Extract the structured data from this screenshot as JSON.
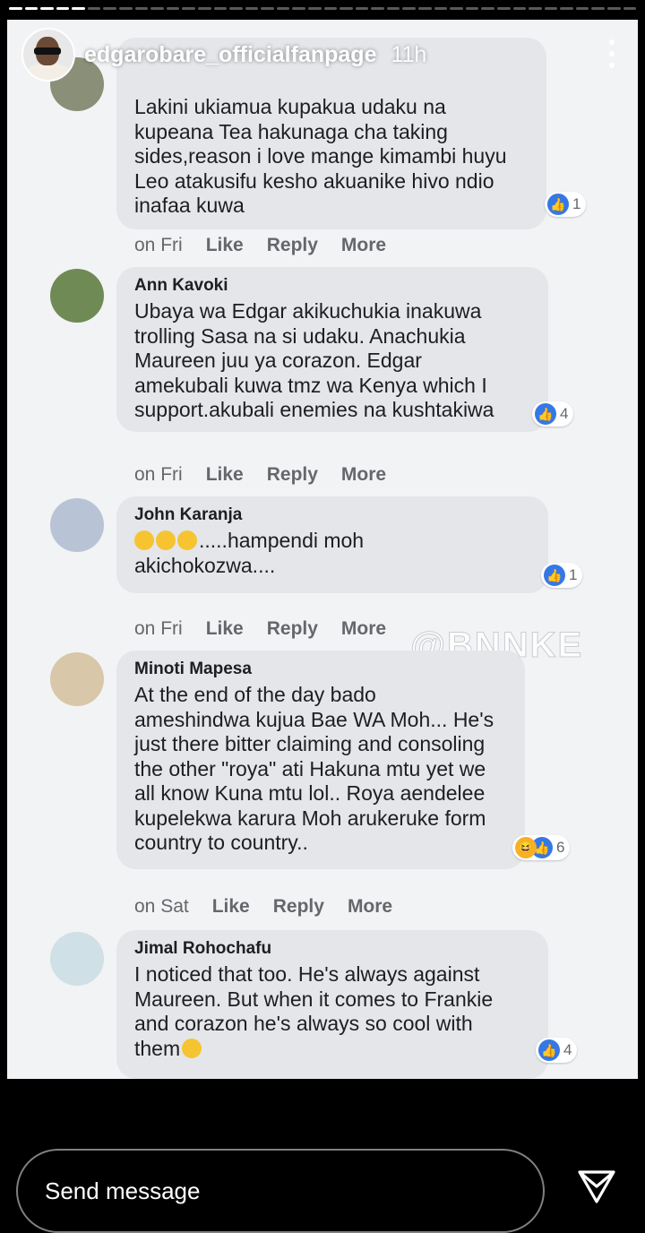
{
  "story": {
    "username": "edgarobare_officialfanpage",
    "time_ago": "11h",
    "progress_segments": 40,
    "progress_done": 5
  },
  "comments": [
    {
      "name": "",
      "text": "Lakini ukiamua kupakua udaku na\nkupeana Tea hakunaga cha taking\nsides,reason i love mange kimambi huyu\nLeo atakusifu kesho akuanike hivo ndio\ninafaa kuwa",
      "reaction_count": "1",
      "reactions": [
        "like"
      ],
      "when": "on Fri",
      "like": "Like",
      "reply": "Reply",
      "more": "More"
    },
    {
      "name": "Ann Kavoki",
      "text": "Ubaya wa Edgar akikuchukia inakuwa\ntrolling Sasa na si udaku. Anachukia\nMaureen juu ya corazon. Edgar\namekubali kuwa tmz wa Kenya which I\nsupport.akubali enemies na kushtakiwa",
      "reaction_count": "4",
      "reactions": [
        "like"
      ],
      "when": "on Fri",
      "like": "Like",
      "reply": "Reply",
      "more": "More"
    },
    {
      "name": "John Karanja",
      "text_before_emoji": "",
      "text_after_emoji": ".....hampendi moh\nakichokozwa....",
      "reaction_count": "1",
      "reactions": [
        "like"
      ],
      "when": "on Fri",
      "like": "Like",
      "reply": "Reply",
      "more": "More"
    },
    {
      "name": "Minoti Mapesa",
      "text": "At the end of the day bado\nameshindwa kujua Bae WA Moh... He's\njust there bitter claiming and consoling\nthe other \"roya\" ati Hakuna mtu yet we\nall know Kuna mtu lol.. Roya aendelee\nkupelekwa karura Moh arukeruke form\ncountry to country..",
      "reaction_count": "6",
      "reactions": [
        "haha",
        "like"
      ],
      "when": "on Sat",
      "like": "Like",
      "reply": "Reply",
      "more": "More"
    },
    {
      "name": "Jimal Rohochafu",
      "text": "I noticed that too. He's always against\nMaureen. But when it comes to Frankie\nand corazon he's always so cool with\nthem",
      "reaction_count": "4",
      "reactions": [
        "like"
      ]
    }
  ],
  "watermark": "@BNNKE",
  "reply_bar": {
    "placeholder": "Send message"
  },
  "colors": {
    "bubble": "#e4e6ea",
    "like_blue": "#3578e5",
    "background": "#f2f3f5",
    "meta_gray": "#65676b"
  }
}
